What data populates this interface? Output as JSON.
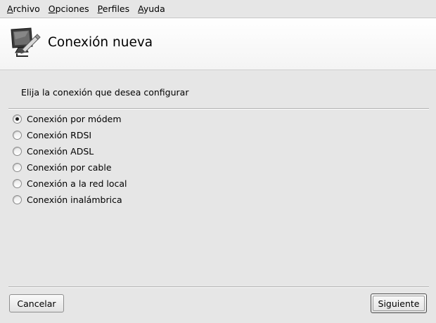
{
  "menubar": {
    "items": [
      {
        "mnemonic": "A",
        "rest": "rchivo"
      },
      {
        "mnemonic": "O",
        "rest": "pciones"
      },
      {
        "mnemonic": "P",
        "rest": "erfiles"
      },
      {
        "mnemonic": "A",
        "rest": "yuda"
      }
    ]
  },
  "header": {
    "icon": "network-computer-icon",
    "title": "Conexión nueva"
  },
  "prompt": "Elija la conexión que desea configurar",
  "options": [
    {
      "label": "Conexión por módem",
      "checked": true
    },
    {
      "label": "Conexión RDSI",
      "checked": false
    },
    {
      "label": "Conexión ADSL",
      "checked": false
    },
    {
      "label": "Conexión por cable",
      "checked": false
    },
    {
      "label": "Conexión a la red local",
      "checked": false
    },
    {
      "label": "Conexión inalámbrica",
      "checked": false
    }
  ],
  "buttons": {
    "cancel": "Cancelar",
    "next": "Siguiente"
  }
}
